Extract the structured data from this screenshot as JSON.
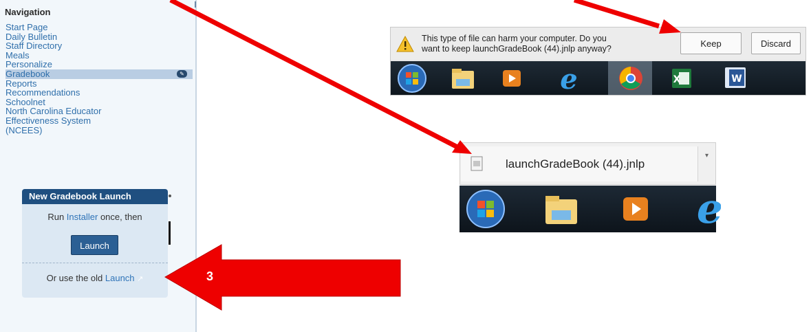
{
  "navigation": {
    "title": "Navigation",
    "items": [
      {
        "label": "Start Page"
      },
      {
        "label": "Daily Bulletin"
      },
      {
        "label": "Staff Directory"
      },
      {
        "label": "Meals"
      },
      {
        "label": "Personalize"
      },
      {
        "label": "Gradebook",
        "active": true
      },
      {
        "label": "Reports"
      },
      {
        "label": "Recommendations"
      },
      {
        "label": "Schoolnet"
      },
      {
        "label": "North Carolina Educator"
      },
      {
        "label": "Effectiveness System"
      },
      {
        "label": "(NCEES)"
      }
    ]
  },
  "widget": {
    "title": "New Gradebook Launch",
    "run_prefix": "Run ",
    "installer_link": "Installer",
    "run_suffix": " once, then",
    "launch_button": "Launch",
    "old_prefix": "Or use the old ",
    "old_link": "Launch"
  },
  "download_warning": {
    "line1": "This type of file can harm your computer. Do you",
    "line2": "want to keep launchGradeBook (44).jnlp anyway?",
    "keep_label": "Keep",
    "discard_label": "Discard",
    "icon": "warning-icon"
  },
  "download_item": {
    "filename": "launchGradeBook (44).jnlp",
    "icon": "file-icon"
  },
  "taskbar_top": {
    "icons": [
      "windows-start-icon",
      "file-explorer-icon",
      "media-player-icon",
      "internet-explorer-icon",
      "chrome-icon",
      "excel-icon",
      "word-icon"
    ]
  },
  "taskbar_bottom": {
    "icons": [
      "windows-start-icon",
      "file-explorer-icon",
      "media-player-icon",
      "internet-explorer-icon"
    ]
  },
  "annotation": {
    "step_label": "3",
    "arrow_color": "#ee0000"
  },
  "colors": {
    "sidebar_bg": "#f2f7fb",
    "nav_link": "#2f6fab",
    "widget_header": "#1f4f80",
    "widget_bg": "#dce8f3",
    "launch_button": "#2b5f94"
  }
}
